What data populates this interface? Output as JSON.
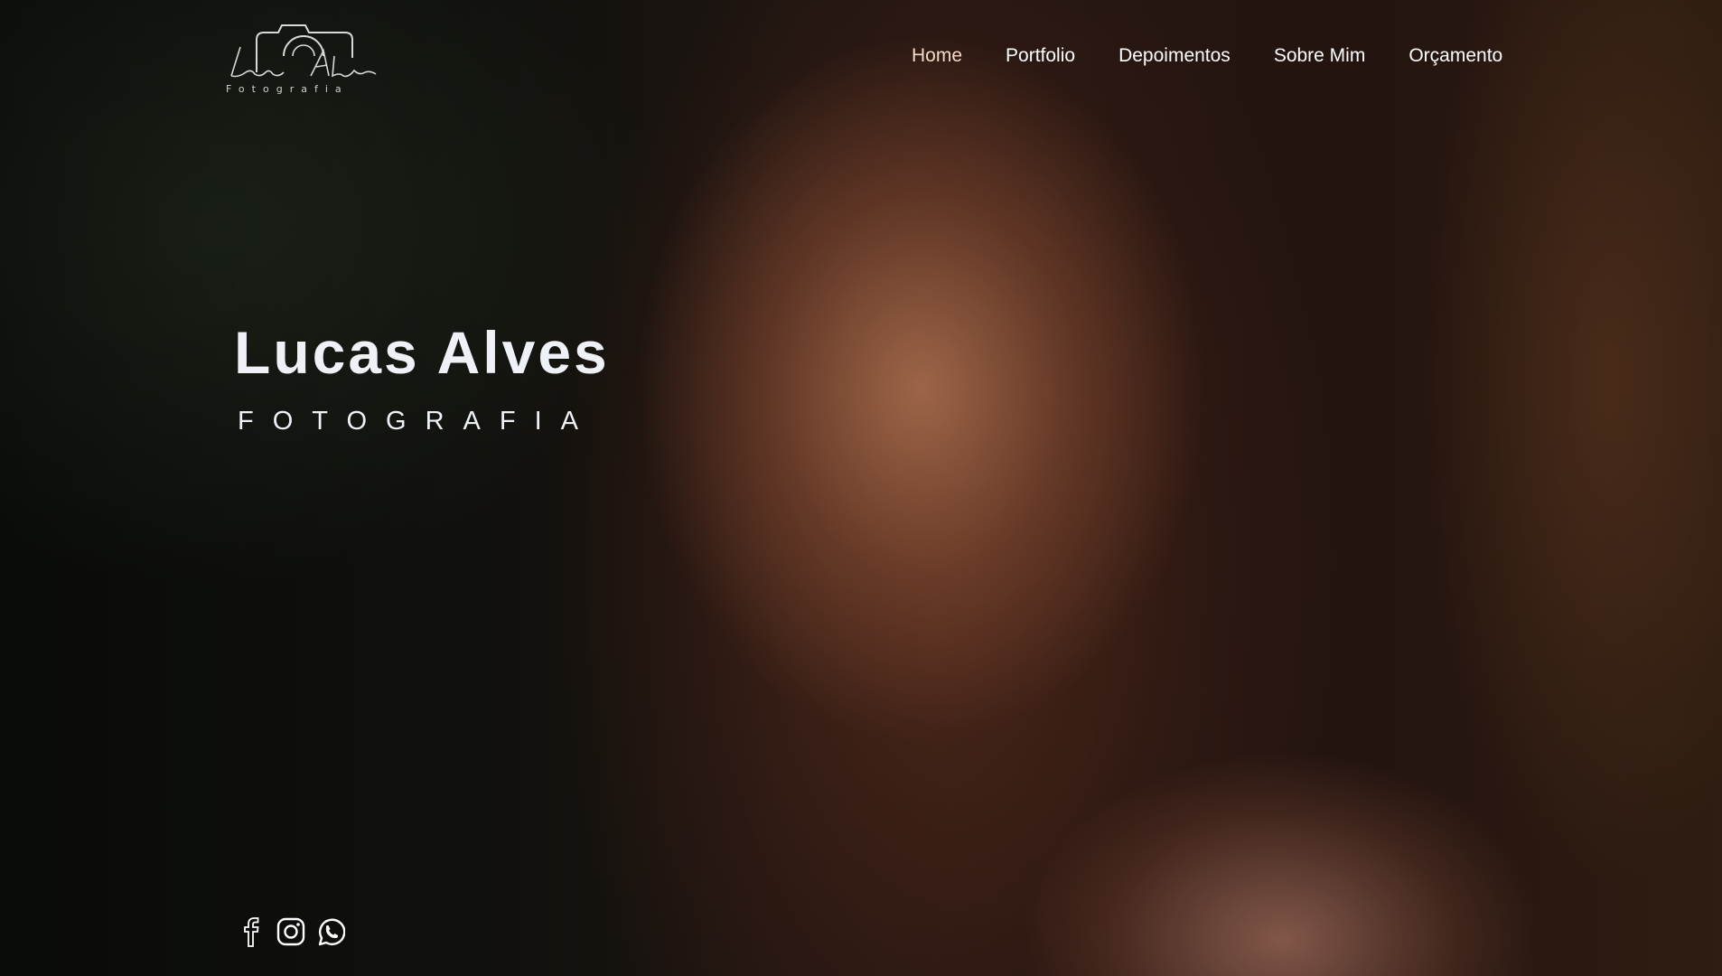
{
  "header": {
    "logo": {
      "script_text": "Lucas Alves",
      "tagline": "Fotografia"
    },
    "nav": [
      {
        "label": "Home",
        "active": true
      },
      {
        "label": "Portfolio",
        "active": false
      },
      {
        "label": "Depoimentos",
        "active": false
      },
      {
        "label": "Sobre Mim",
        "active": false
      },
      {
        "label": "Orçamento",
        "active": false
      }
    ]
  },
  "hero": {
    "title": "Lucas Alves",
    "subtitle": "FOTOGRAFIA"
  },
  "social": {
    "icons": [
      "facebook-icon",
      "instagram-icon",
      "whatsapp-icon"
    ]
  },
  "colors": {
    "nav_active": "#f4d9c6",
    "text_light": "#eef2f7"
  }
}
